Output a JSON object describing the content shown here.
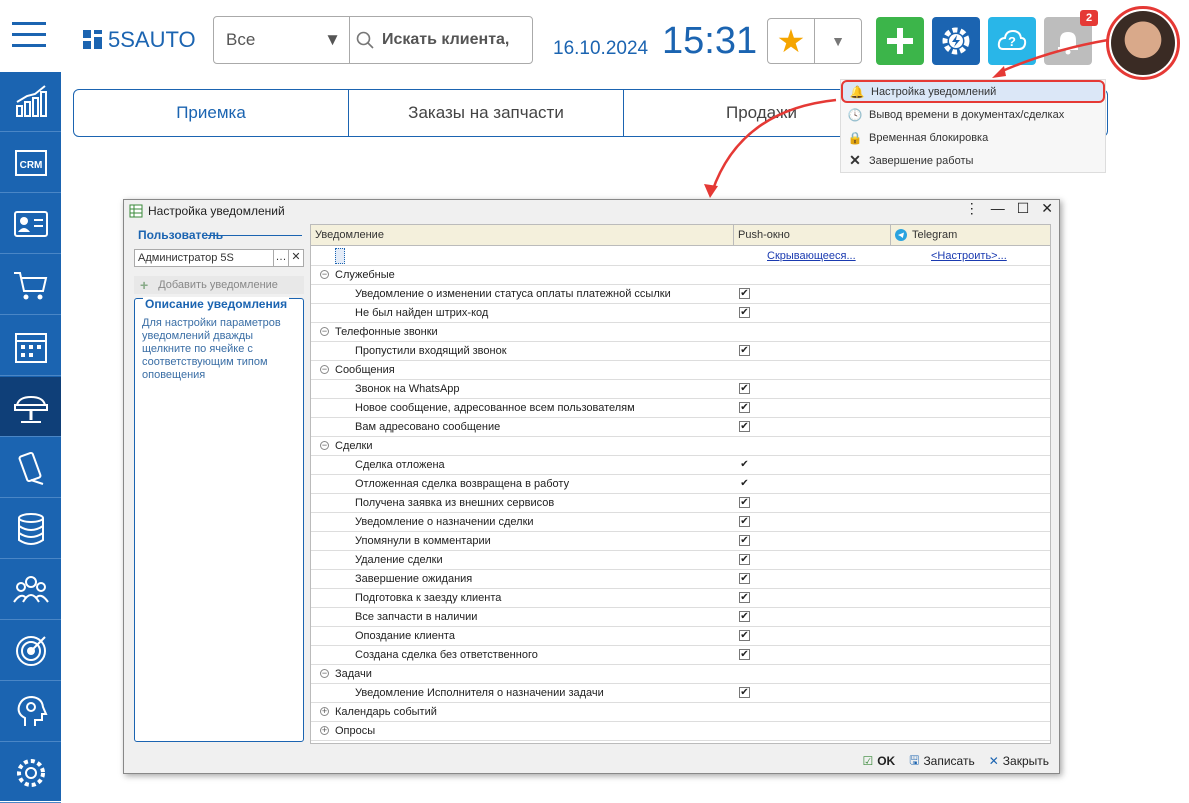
{
  "app": {
    "logo_text": "5SAUTO"
  },
  "search": {
    "scope": "Все",
    "placeholder": "Искать клиента,"
  },
  "header": {
    "date": "16.10.2024",
    "time": "15:31",
    "notifications_count": "2"
  },
  "tabs": [
    {
      "label": "Приемка"
    },
    {
      "label": "Заказы на запчасти"
    },
    {
      "label": "Продажи"
    }
  ],
  "context_menu": [
    {
      "label": "Настройка уведомлений",
      "icon": "bell-icon"
    },
    {
      "label": "Вывод времени в документах/сделках",
      "icon": "clock-icon"
    },
    {
      "label": "Временная блокировка",
      "icon": "lock-icon"
    },
    {
      "label": "Завершение работы",
      "icon": "close-icon"
    }
  ],
  "dialog": {
    "title": "Настройка уведомлений",
    "user_label": "Пользователь",
    "user_value": "Администратор 5S",
    "add_label": "Добавить уведомление",
    "desc_title": "Описание уведомления",
    "desc_text": "Для настройки параметров уведомлений дважды щелкните по ячейке с соответствующим типом оповещения",
    "columns": {
      "notification": "Уведомление",
      "push": "Push-окно",
      "telegram": "Telegram"
    },
    "push_link": "Скрывающееся...",
    "telegram_link": "<Настроить>...",
    "ok_label": "OK",
    "save_label": "Записать",
    "close_label": "Закрыть"
  },
  "rows": [
    {
      "type": "group",
      "label": "Служебные",
      "open": true
    },
    {
      "type": "item",
      "label": "Уведомление о изменении статуса оплаты платежной ссылки",
      "push": true
    },
    {
      "type": "item",
      "label": "Не был найден штрих-код",
      "push": true
    },
    {
      "type": "group",
      "label": "Телефонные звонки",
      "open": true
    },
    {
      "type": "item",
      "label": "Пропустили входящий звонок",
      "push": true
    },
    {
      "type": "group",
      "label": "Сообщения",
      "open": true
    },
    {
      "type": "item",
      "label": "Звонок на WhatsApp",
      "push": true
    },
    {
      "type": "item",
      "label": "Новое сообщение, адресованное всем пользователям",
      "push": true
    },
    {
      "type": "item",
      "label": "Вам адресовано сообщение",
      "push": true
    },
    {
      "type": "group",
      "label": "Сделки",
      "open": true
    },
    {
      "type": "item",
      "label": "Сделка отложена",
      "push": true,
      "plain": true
    },
    {
      "type": "item",
      "label": "Отложенная сделка возвращена в работу",
      "push": true,
      "plain": true
    },
    {
      "type": "item",
      "label": "Получена заявка из внешних сервисов",
      "push": true
    },
    {
      "type": "item",
      "label": "Уведомление о назначении сделки",
      "push": true
    },
    {
      "type": "item",
      "label": "Упомянули в комментарии",
      "push": true
    },
    {
      "type": "item",
      "label": "Удаление сделки",
      "push": true
    },
    {
      "type": "item",
      "label": "Завершение ожидания",
      "push": true
    },
    {
      "type": "item",
      "label": "Подготовка к заезду клиента",
      "push": true
    },
    {
      "type": "item",
      "label": "Все запчасти в наличии",
      "push": true
    },
    {
      "type": "item",
      "label": "Опоздание клиента",
      "push": true
    },
    {
      "type": "item",
      "label": "Создана сделка без ответственного",
      "push": true
    },
    {
      "type": "group",
      "label": "Задачи",
      "open": true
    },
    {
      "type": "item",
      "label": "Уведомление Исполнителя о назначении задачи",
      "push": true
    },
    {
      "type": "group",
      "label": "Календарь событий",
      "open": false
    },
    {
      "type": "group",
      "label": "Опросы",
      "open": false
    }
  ],
  "sidebar": [
    {
      "icon": "chart-icon"
    },
    {
      "icon": "crm-icon"
    },
    {
      "icon": "contacts-icon"
    },
    {
      "icon": "cart-icon"
    },
    {
      "icon": "calendar-icon"
    },
    {
      "icon": "car-lift-icon",
      "active": true
    },
    {
      "icon": "phone-icon"
    },
    {
      "icon": "database-icon"
    },
    {
      "icon": "team-icon"
    },
    {
      "icon": "target-icon"
    },
    {
      "icon": "head-icon"
    },
    {
      "icon": "gear-icon"
    }
  ],
  "colors": {
    "brand": "#1b64b1",
    "accent_red": "#e53935",
    "green": "#3cb54a"
  }
}
